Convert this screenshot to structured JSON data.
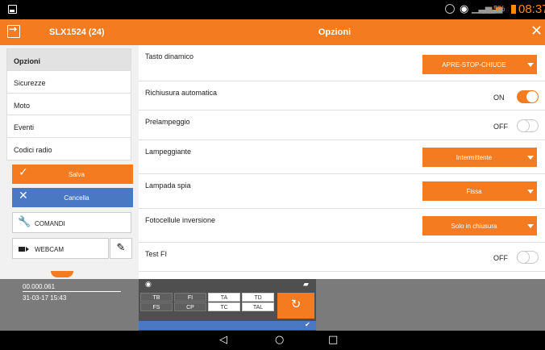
{
  "status_bar": {
    "battery": "5%",
    "time": "08:37",
    "icons": [
      "gallery-icon",
      "rotation-icon",
      "wifi-icon",
      "signal-icon",
      "signal-icon",
      "battery-icon"
    ]
  },
  "app_bar": {
    "device": "SLX1524 (24)",
    "title": "Opzioni",
    "icons": [
      "back-icon",
      "close-icon"
    ]
  },
  "menu": {
    "items": [
      {
        "label": "Opzioni",
        "active": true
      },
      {
        "label": "Sicurezze",
        "active": false
      },
      {
        "label": "Moto",
        "active": false
      },
      {
        "label": "Eventi",
        "active": false
      },
      {
        "label": "Codici radio",
        "active": false
      }
    ]
  },
  "actions": {
    "save": "Salva",
    "cancel": "Cancella",
    "commands": "COMANDI",
    "webcam": "WEBCAM"
  },
  "options": [
    {
      "label": "Tasto dinamico",
      "type": "dropdown",
      "value": "APRE-STOP-CHIUDE"
    },
    {
      "label": "Richiusura automatica",
      "type": "toggle",
      "state": "ON"
    },
    {
      "label": "Prelampeggio",
      "type": "toggle",
      "state": "OFF"
    },
    {
      "label": "Lampeggiante",
      "type": "dropdown",
      "value": "Intermittente"
    },
    {
      "label": "Lampada spia",
      "type": "dropdown",
      "value": "Fissa"
    },
    {
      "label": "Fotocellule inversione",
      "type": "dropdown",
      "value": "Solo in chiusura"
    },
    {
      "label": "Test FI",
      "type": "toggle",
      "state": "OFF"
    }
  ],
  "bottom": {
    "serial": "00.000.061",
    "datetime": "31-03-17 15:43",
    "inputs_row1": [
      "TB",
      "FI",
      "TA",
      "TD"
    ],
    "inputs_row2": [
      "FS",
      "CP",
      "TC",
      "TAL"
    ],
    "icons": [
      "wifi-icon",
      "power-plug-icon",
      "refresh-icon",
      "check-icon"
    ]
  },
  "nav_bar": {
    "icons": [
      "back-triangle-icon",
      "home-circle-icon",
      "recents-square-icon"
    ]
  },
  "colors": {
    "accent": "#f47b20",
    "blue": "#4a78c2",
    "panel": "#7b7b7b"
  }
}
